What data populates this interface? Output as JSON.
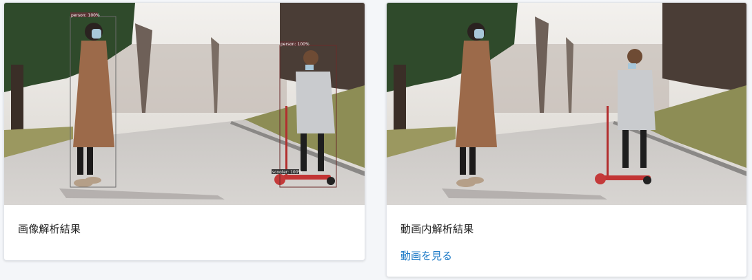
{
  "cards": [
    {
      "caption": "画像解析結果",
      "detections": [
        {
          "label": "person: 100%"
        },
        {
          "label": "person: 100%"
        },
        {
          "label": "scooter: 100%"
        }
      ]
    },
    {
      "caption": "動画内解析結果",
      "link_label": "動画を見る"
    }
  ],
  "colors": {
    "link": "#1f7bc7",
    "bbox": "#6b2a2a"
  }
}
